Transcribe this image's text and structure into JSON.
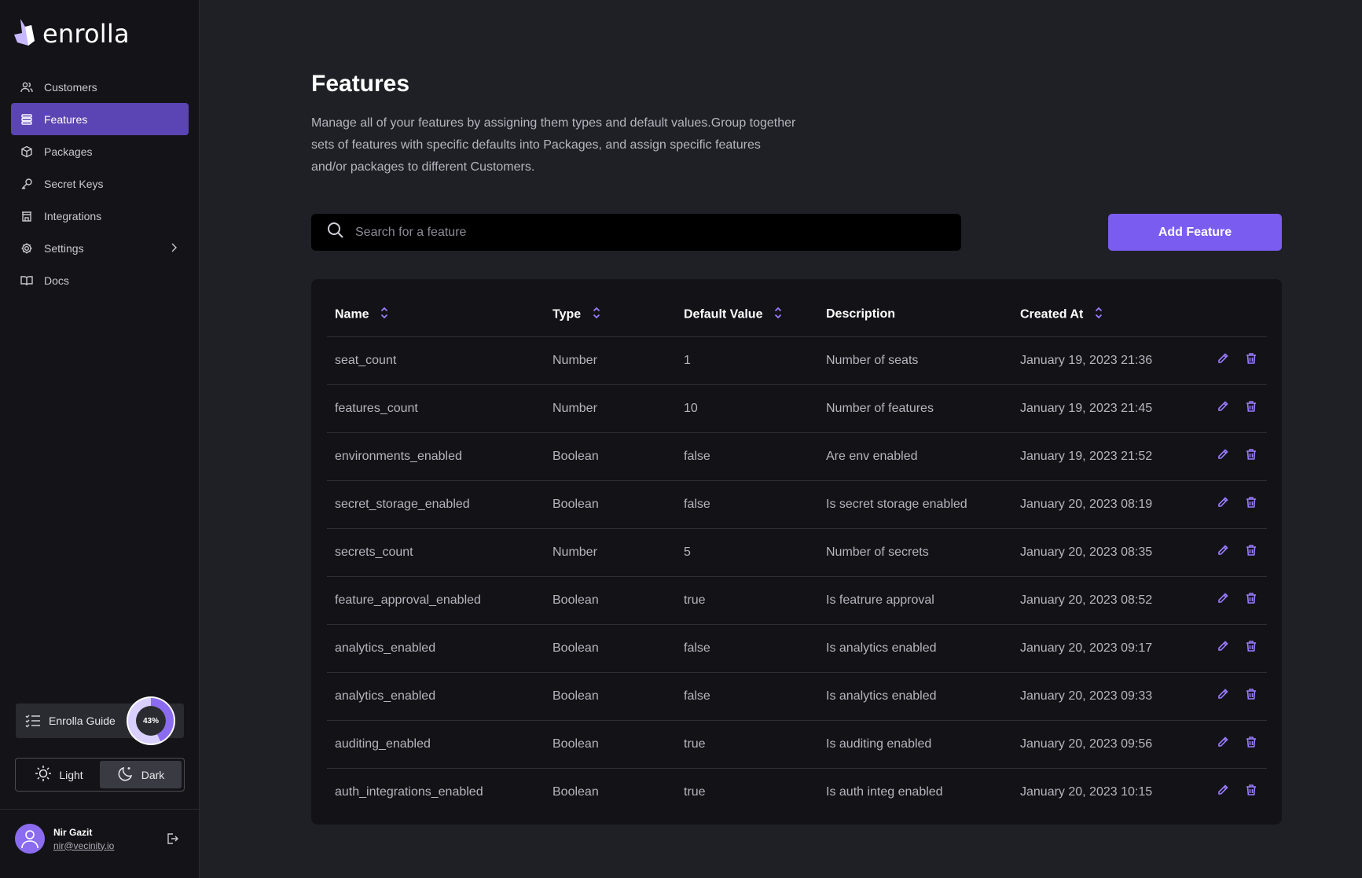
{
  "brand": {
    "name": "enrolla"
  },
  "sidebar": {
    "items": [
      {
        "label": "Customers",
        "icon": "users-icon",
        "active": false
      },
      {
        "label": "Features",
        "icon": "list-icon",
        "active": true
      },
      {
        "label": "Packages",
        "icon": "package-icon",
        "active": false
      },
      {
        "label": "Secret Keys",
        "icon": "key-icon",
        "active": false
      },
      {
        "label": "Integrations",
        "icon": "building-icon",
        "active": false
      },
      {
        "label": "Settings",
        "icon": "gear-icon",
        "active": false
      },
      {
        "label": "Docs",
        "icon": "book-icon",
        "active": false
      }
    ],
    "guide": {
      "label": "Enrolla Guide",
      "progress_percent": 43,
      "progress_text": "43%"
    },
    "theme": {
      "light_label": "Light",
      "dark_label": "Dark",
      "selected": "Dark"
    },
    "user": {
      "name": "Nir Gazit",
      "email": "nir@vecinity.io"
    }
  },
  "main": {
    "title": "Features",
    "description": "Manage all of your features by assigning them types and default values.Group together sets of features with specific defaults into Packages, and assign specific features and/or packages to different Customers.",
    "search": {
      "placeholder": "Search for a feature",
      "value": ""
    },
    "add_button": "Add Feature",
    "table": {
      "columns": [
        "Name",
        "Type",
        "Default Value",
        "Description",
        "Created At"
      ],
      "rows": [
        [
          "seat_count",
          "Number",
          "1",
          "Number of seats",
          "January 19, 2023 21:36"
        ],
        [
          "features_count",
          "Number",
          "10",
          "Number of features",
          "January 19, 2023 21:45"
        ],
        [
          "environments_enabled",
          "Boolean",
          "false",
          "Are env enabled",
          "January 19, 2023 21:52"
        ],
        [
          "secret_storage_enabled",
          "Boolean",
          "false",
          "Is secret storage enabled",
          "January 20, 2023 08:19"
        ],
        [
          "secrets_count",
          "Number",
          "5",
          "Number of secrets",
          "January 20, 2023 08:35"
        ],
        [
          "feature_approval_enabled",
          "Boolean",
          "true",
          "Is featrure approval",
          "January 20, 2023 08:52"
        ],
        [
          "analytics_enabled",
          "Boolean",
          "false",
          "Is analytics enabled",
          "January 20, 2023 09:17"
        ],
        [
          "analytics_enabled",
          "Boolean",
          "false",
          "Is analytics enabled",
          "January 20, 2023 09:33"
        ],
        [
          "auditing_enabled",
          "Boolean",
          "true",
          "Is auditing enabled",
          "January 20, 2023 09:56"
        ],
        [
          "auth_integrations_enabled",
          "Boolean",
          "true",
          "Is auth integ enabled",
          "January 20, 2023 10:15"
        ]
      ]
    }
  },
  "colors": {
    "accent": "#7b5cf0",
    "active_nav": "#5b44b4",
    "background": "#1f2025",
    "sidebar": "#141418",
    "card": "#131317"
  }
}
